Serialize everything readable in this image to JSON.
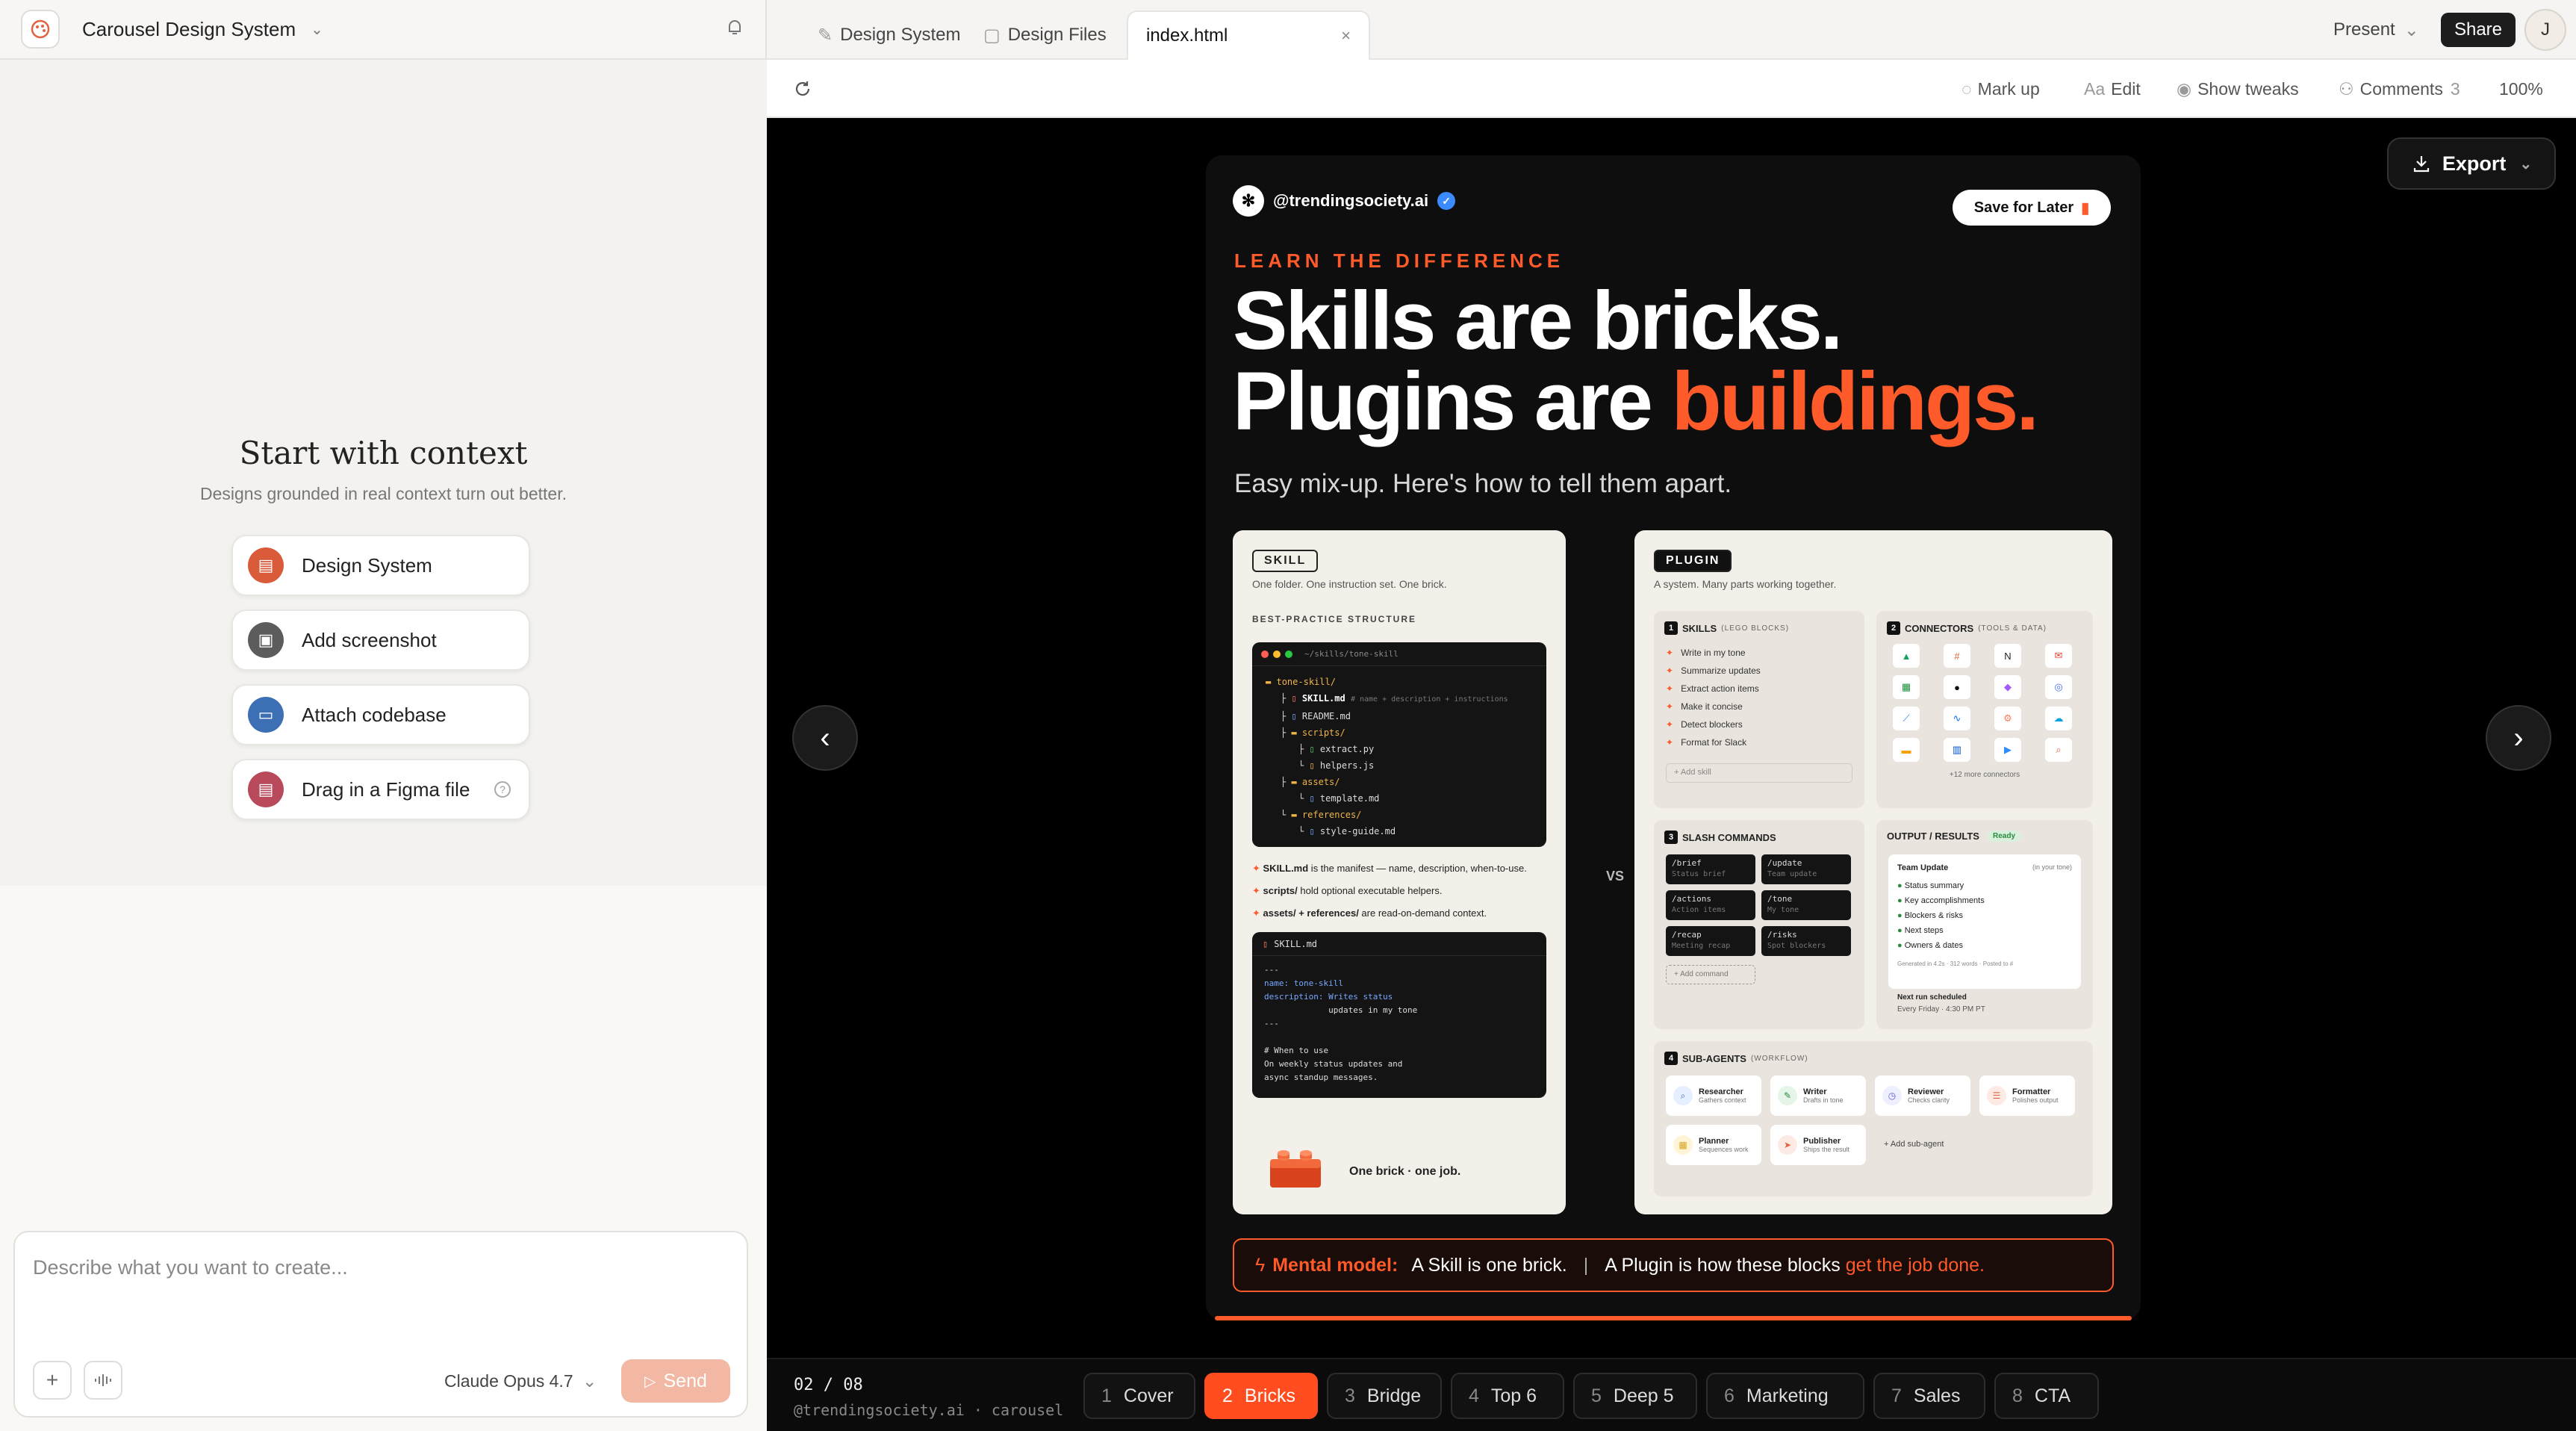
{
  "project": {
    "title": "Carousel Design System"
  },
  "context_panel": {
    "title": "Start with context",
    "subtitle": "Designs grounded in real context turn out better.",
    "options": [
      {
        "label": "Design System",
        "icon": "document-icon",
        "color": "#d95b3a"
      },
      {
        "label": "Add screenshot",
        "icon": "image-icon",
        "color": "#5c5c5c"
      },
      {
        "label": "Attach codebase",
        "icon": "folder-icon",
        "color": "#3d6fb5"
      },
      {
        "label": "Drag in a Figma file",
        "icon": "figma-file-icon",
        "color": "#b94a5c"
      }
    ]
  },
  "composer": {
    "placeholder": "Describe what you want to create...",
    "model": "Claude Opus 4.7",
    "send_label": "Send"
  },
  "tabs": [
    {
      "label": "Design System"
    },
    {
      "label": "Design Files"
    },
    {
      "label": "index.html"
    }
  ],
  "header": {
    "present_label": "Present",
    "share_label": "Share",
    "avatar_initial": "J"
  },
  "toolbar": {
    "markup": "Mark up",
    "edit": "Edit",
    "tweaks": "Show tweaks",
    "comments": "Comments",
    "comments_count": "3",
    "zoom": "100%"
  },
  "stage": {
    "export_label": "Export"
  },
  "slide": {
    "handle": "@trendingsociety.ai",
    "save_label": "Save for Later",
    "eyebrow": "LEARN THE DIFFERENCE",
    "headline_line1": "Skills are bricks.",
    "headline_line2_pre": "Plugins are ",
    "headline_line2_hl": "buildings.",
    "dek": "Easy mix-up. Here's how to tell them apart.",
    "vs": "VS",
    "skill": {
      "tag": "SKILL",
      "desc": "One folder. One instruction set. One brick.",
      "structure_label": "BEST-PRACTICE STRUCTURE",
      "path": "~/skills/tone-skill",
      "tree": [
        "tone-skill/",
        "SKILL.md",
        "README.md",
        "scripts/",
        "extract.py",
        "helpers.js",
        "assets/",
        "template.md",
        "references/",
        "style-guide.md"
      ],
      "tree_comment": "# name + description + instructions",
      "notes": [
        {
          "bold": "SKILL.md",
          "text": " is the manifest — name, description, when-to-use."
        },
        {
          "bold": "scripts/",
          "text": " hold optional executable helpers."
        },
        {
          "bold": "assets/ + references/",
          "text": " are read-on-demand context."
        }
      ],
      "file_name": "SKILL.md",
      "file_lines": [
        "---",
        "name: tone-skill",
        "description: Writes status",
        "             updates in my tone",
        "---",
        "",
        "# When to use",
        "On weekly status updates and",
        "async standup messages."
      ],
      "footer": "One brick · one job."
    },
    "plugin": {
      "tag": "PLUGIN",
      "desc": "A system. Many parts working together.",
      "skills_title": "SKILLS",
      "skills_sub": "(LEGO BLOCKS)",
      "skills": [
        "Write in my tone",
        "Summarize updates",
        "Extract action items",
        "Make it concise",
        "Detect blockers",
        "Format for Slack"
      ],
      "add_skill": "+ Add skill",
      "connectors_title": "CONNECTORS",
      "connectors_sub": "(TOOLS & DATA)",
      "connectors_more": "+12 more connectors",
      "slash_title": "SLASH COMMANDS",
      "commands": [
        {
          "cmd": "/brief",
          "desc": "Status brief"
        },
        {
          "cmd": "/update",
          "desc": "Team update"
        },
        {
          "cmd": "/actions",
          "desc": "Action items"
        },
        {
          "cmd": "/tone",
          "desc": "My tone"
        },
        {
          "cmd": "/recap",
          "desc": "Meeting recap"
        },
        {
          "cmd": "/risks",
          "desc": "Spot blockers"
        }
      ],
      "add_command": "+ Add command",
      "output_title": "OUTPUT / RESULTS",
      "output_badge": "Ready",
      "output_doc_title": "Team Update",
      "output_doc_tag": "(in your tone)",
      "output_items": [
        "Status summary",
        "Key accomplishments",
        "Blockers & risks",
        "Next steps",
        "Owners & dates"
      ],
      "output_meta": "Generated in 4.2s · 312 words · Posted to #",
      "next_run": "Next run scheduled",
      "next_run_time": "Every Friday · 4:30 PM PT",
      "agents_title": "SUB-AGENTS",
      "agents_sub": "(WORKFLOW)",
      "agents": [
        {
          "name": "Researcher",
          "desc": "Gathers context"
        },
        {
          "name": "Writer",
          "desc": "Drafts in tone"
        },
        {
          "name": "Reviewer",
          "desc": "Checks clarity"
        },
        {
          "name": "Formatter",
          "desc": "Polishes output"
        },
        {
          "name": "Planner",
          "desc": "Sequences work"
        },
        {
          "name": "Publisher",
          "desc": "Ships the result"
        }
      ],
      "add_agent": "+ Add sub-agent"
    },
    "mental_label": "Mental model:",
    "mental_a": "A Skill is one brick.",
    "mental_sep": "|",
    "mental_b_pre": "A Plugin is how these blocks ",
    "mental_b_hl": "get the job done."
  },
  "bottom": {
    "counter": "02 / 08",
    "caption": "@trendingsociety.ai · carousel",
    "slides": [
      {
        "n": "1",
        "label": "Cover"
      },
      {
        "n": "2",
        "label": "Bricks"
      },
      {
        "n": "3",
        "label": "Bridge"
      },
      {
        "n": "4",
        "label": "Top 6"
      },
      {
        "n": "5",
        "label": "Deep 5"
      },
      {
        "n": "6",
        "label": "Marketing"
      },
      {
        "n": "7",
        "label": "Sales"
      },
      {
        "n": "8",
        "label": "CTA"
      }
    ]
  },
  "colors": {
    "accent": "#ff5a2a",
    "stage_bg": "#000000"
  }
}
